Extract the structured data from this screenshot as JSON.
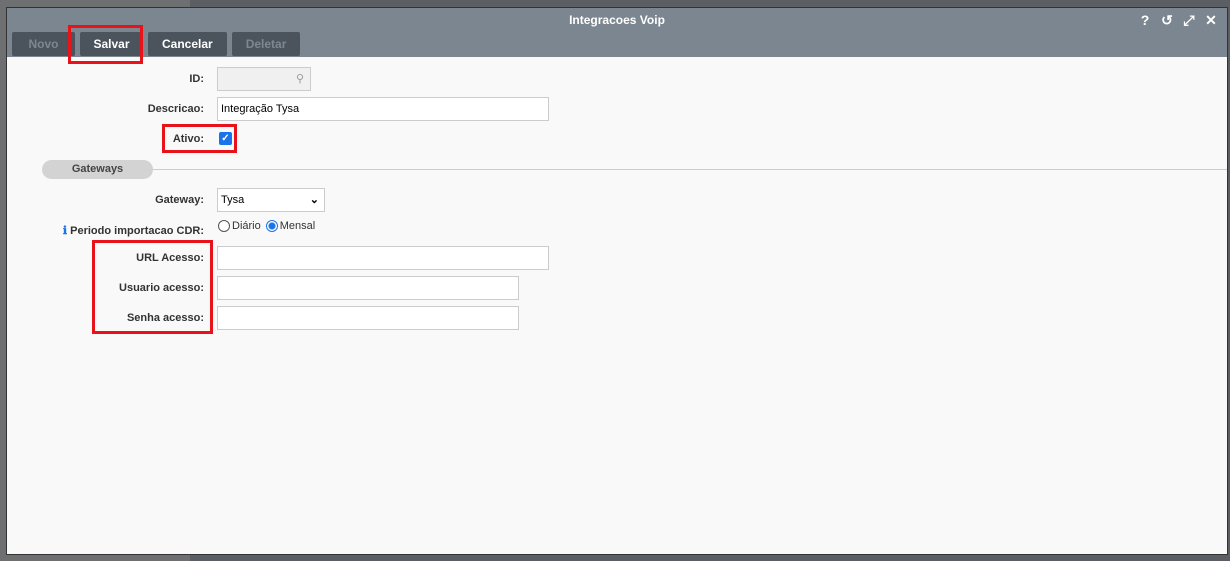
{
  "dialog": {
    "title": "Integracoes Voip",
    "icons": [
      "help-icon",
      "history-icon",
      "maximize-icon",
      "close-icon"
    ]
  },
  "toolbar": {
    "novo": "Novo",
    "salvar": "Salvar",
    "cancelar": "Cancelar",
    "deletar": "Deletar"
  },
  "form": {
    "id_label": "ID:",
    "id_value": "",
    "descricao_label": "Descricao:",
    "descricao_value": "Integração Tysa",
    "ativo_label": "Ativo:",
    "ativo_checked": true,
    "section": "Gateways",
    "gateway_label": "Gateway:",
    "gateway_value": "Tysa",
    "periodo_label": "Periodo importacao CDR:",
    "periodo_options": [
      "Diário",
      "Mensal"
    ],
    "periodo_selected": "Mensal",
    "url_label": "URL Acesso:",
    "url_value": "",
    "usuario_label": "Usuario acesso:",
    "usuario_value": "",
    "senha_label": "Senha acesso:",
    "senha_value": ""
  },
  "colors": {
    "highlight": "#e8121b",
    "titlebar": "#7c8690",
    "button": "#4b545c"
  }
}
